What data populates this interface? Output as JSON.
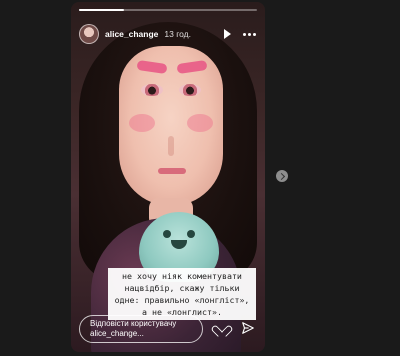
{
  "story": {
    "username": "alice_change",
    "time_ago": "13 год.",
    "progress": 0.25,
    "caption_lines": [
      "не хочу ніяк коментувати",
      "нацвідбір, скажу тільки",
      "одне: правильно «лонгліст»,",
      "а не «лонглист»."
    ],
    "reply_placeholder_lines": [
      "Відповісти користувачу",
      "alice_change..."
    ]
  },
  "icons": {
    "play": "play-icon",
    "more": "more-icon",
    "like": "heart-icon",
    "share": "send-icon",
    "next": "chevron-right-icon"
  }
}
